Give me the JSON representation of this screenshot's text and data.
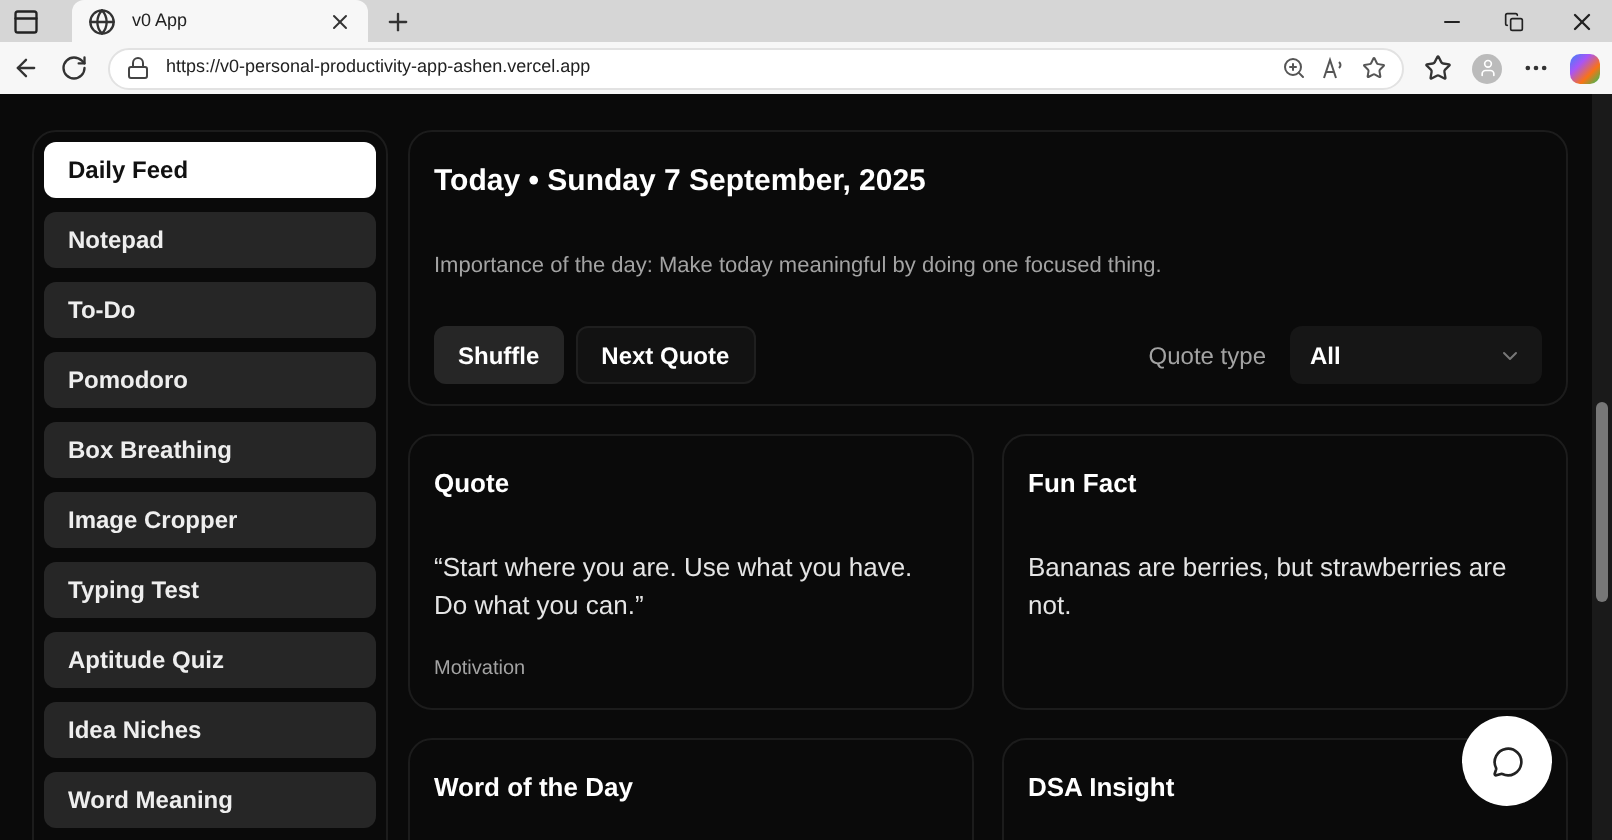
{
  "browser": {
    "tab_title": "v0 App",
    "url": "https://v0-personal-productivity-app-ashen.vercel.app"
  },
  "sidebar": {
    "items": [
      {
        "label": "Daily Feed",
        "selected": true
      },
      {
        "label": "Notepad",
        "selected": false
      },
      {
        "label": "To-Do",
        "selected": false
      },
      {
        "label": "Pomodoro",
        "selected": false
      },
      {
        "label": "Box Breathing",
        "selected": false
      },
      {
        "label": "Image Cropper",
        "selected": false
      },
      {
        "label": "Typing Test",
        "selected": false
      },
      {
        "label": "Aptitude Quiz",
        "selected": false
      },
      {
        "label": "Idea Niches",
        "selected": false
      },
      {
        "label": "Word Meaning",
        "selected": false
      }
    ]
  },
  "header": {
    "title": "Today • Sunday 7 September, 2025",
    "importance": "Importance of the day: Make today meaningful by doing one focused thing.",
    "buttons": [
      {
        "label": "Shuffle",
        "kind": "secondary"
      },
      {
        "label": "Next Quote",
        "kind": "ghost"
      }
    ],
    "quote_type": {
      "label": "Quote type",
      "value": "All"
    }
  },
  "cards": [
    {
      "title": "Quote",
      "body": "“Start where you are. Use what you have. Do what you can.”",
      "footer": "Motivation"
    },
    {
      "title": "Fun Fact",
      "body": "Bananas are berries, but strawberries are not."
    },
    {
      "title": "Word of the Day"
    },
    {
      "title": "DSA Insight"
    }
  ]
}
